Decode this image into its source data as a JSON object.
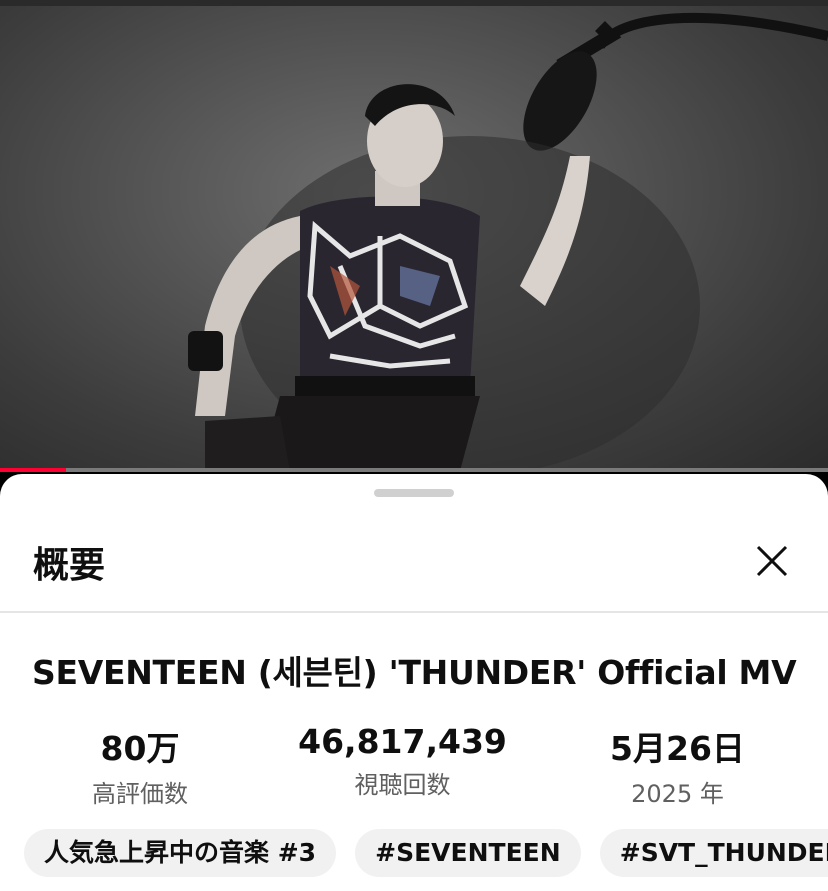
{
  "video": {
    "progress_fraction": 0.08
  },
  "sheet": {
    "title": "概要",
    "close_icon": "close-icon"
  },
  "description": {
    "video_title": "SEVENTEEN (세븐틴) 'THUNDER' Official MV",
    "stats": {
      "likes": {
        "value": "80万",
        "label": "高評価数"
      },
      "views": {
        "value": "46,817,439",
        "label": "視聴回数"
      },
      "date": {
        "value": "5月26日",
        "label": "2025 年"
      }
    },
    "chips": [
      {
        "label": "人気急上昇中の音楽 #3"
      },
      {
        "label": "#SEVENTEEN"
      },
      {
        "label": "#SVT_THUNDER"
      }
    ]
  },
  "colors": {
    "progress": "#ff0033",
    "sheet_bg": "#ffffff",
    "chip_bg": "#f1f1f1",
    "secondary_text": "#606060"
  }
}
